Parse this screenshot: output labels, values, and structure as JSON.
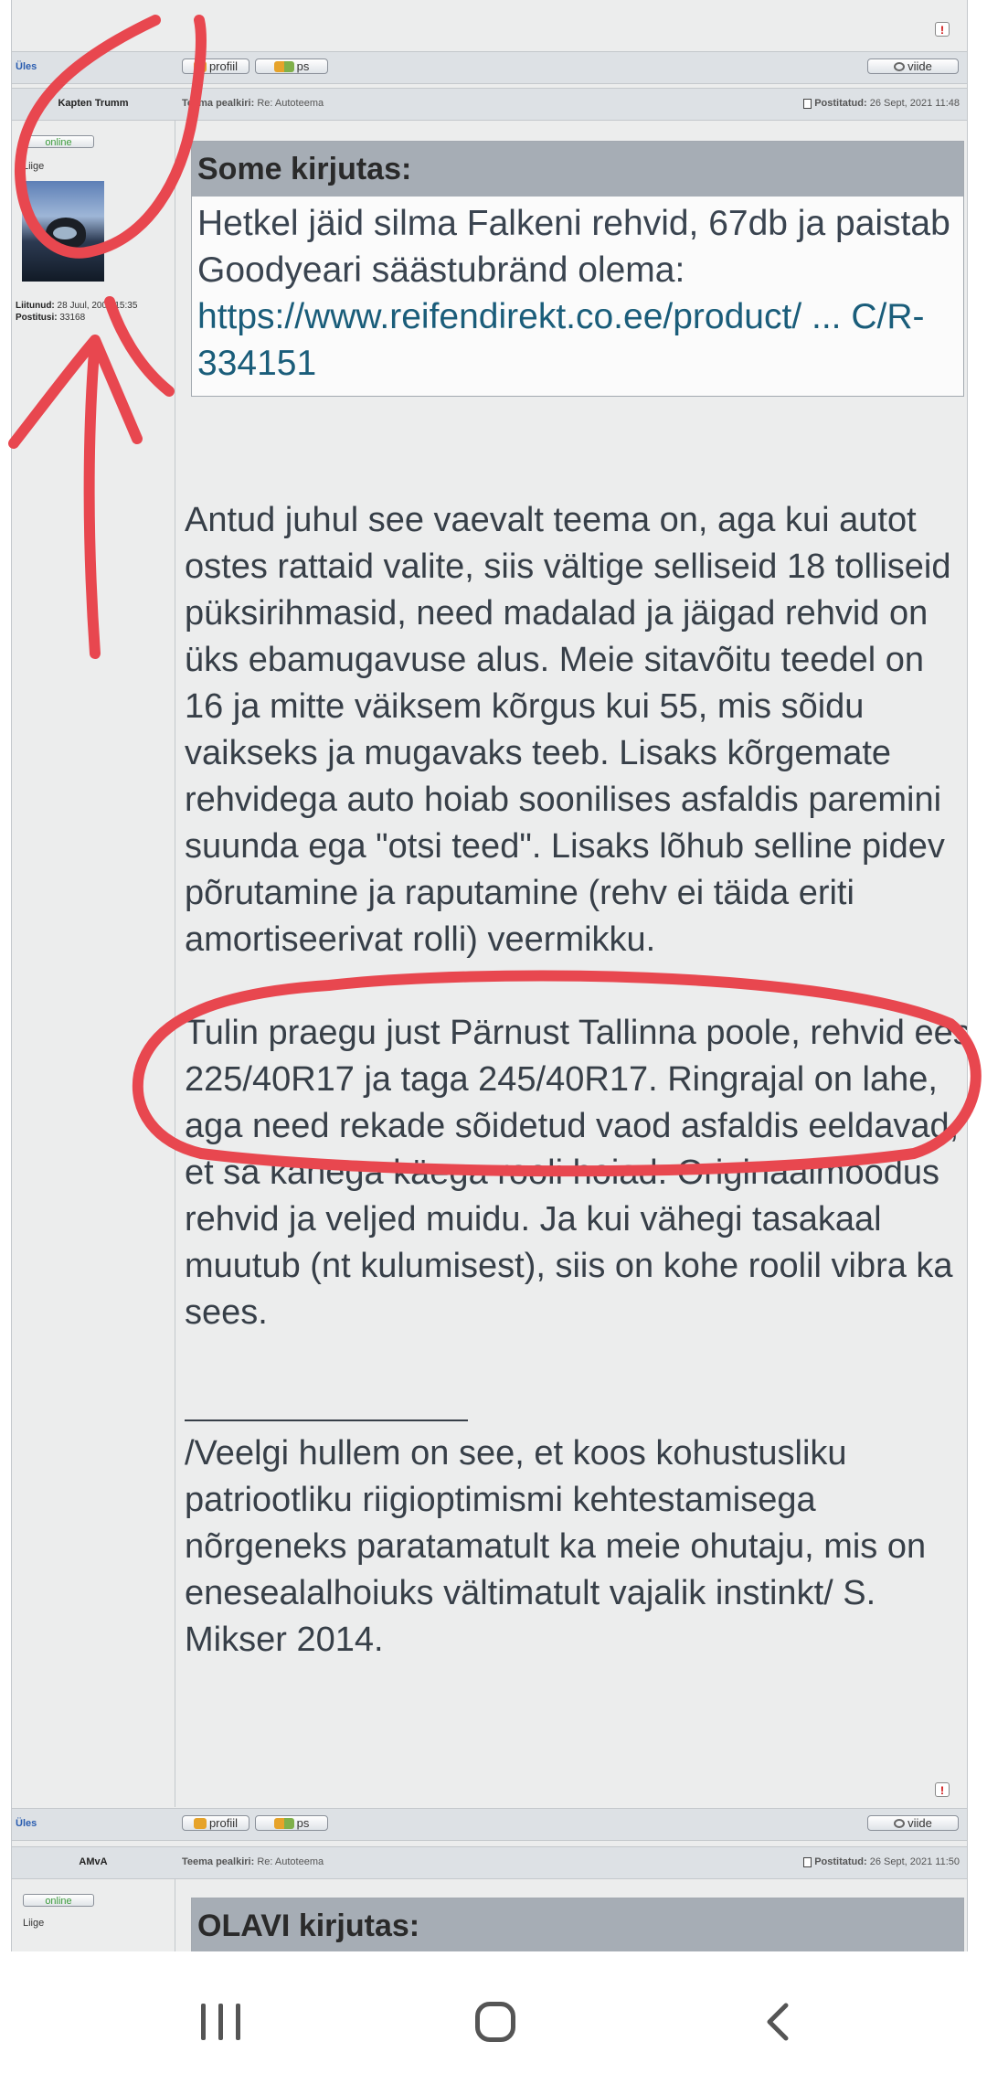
{
  "post1": {
    "top_report": "!",
    "up_link": "Üles",
    "profile_btn": "profiil",
    "pm_btn": "ps",
    "quote_btn": "viide",
    "author": "Kapten Trumm",
    "subject_label": "Teema pealkiri:",
    "subject_value": "Re: Autoteema",
    "posted_label": "Postitatud:",
    "posted_value": "26 Sept, 2021 11:48",
    "online_badge": "online",
    "rank": "Liige",
    "joined_label": "Liitunud:",
    "joined_value": "28 Juul, 2005 15:35",
    "posts_label": "Postitusi:",
    "posts_value": "33168",
    "quote_header": "Some kirjutas:",
    "quote_text": "Hetkel jäid silma Falkeni rehvid, 67db ja paistab Goodyeari säästubränd olema:",
    "quote_link": "https://www.reifendirekt.co.ee/product/ ... C/R-334151",
    "para1": "Antud juhul see vaevalt teema on, aga kui autot ostes rattaid valite, siis vältige selliseid 18 tolliseid püksirihmasid, need madalad ja jäigad rehvid on üks ebamugavuse alus. Meie sitavõitu teedel on 16 ja mitte väiksem kõrgus kui 55, mis sõidu vaikseks ja mugavaks teeb. Lisaks kõrgemate rehvidega auto hoiab soonilises asfaldis paremini suunda ega \"otsi teed\". Lisaks lõhub selline pidev põrutamine ja raputamine (rehv ei täida eriti amortiseerivat rolli) veermikku.",
    "para2": "Tulin praegu just Pärnust Tallinna poole, rehvid ees 225/40R17 ja taga 245/40R17. Ringrajal on lahe, aga need rekade sõidetud vaod asfaldis eeldavad, et sa kahega käega rooli hoiad. Originaalmõõdus rehvid ja veljed muidu. Ja kui vähegi tasakaal muutub (nt kulumisest), siis on kohe roolil vibra ka sees.",
    "signature": "/Veelgi hullem on see, et koos kohustusliku patriootliku riigioptimismi kehtestamisega nõrgeneks paratamatult ka meie ohutaju, mis on enesealalhoiuks vältimatult vajalik instinkt/ S. Mikser 2014.",
    "bottom_report": "!"
  },
  "post2": {
    "up_link": "Üles",
    "profile_btn": "profiil",
    "pm_btn": "ps",
    "quote_btn": "viide",
    "author": "AMvA",
    "subject_label": "Teema pealkiri:",
    "subject_value": "Re: Autoteema",
    "posted_label": "Postitatud:",
    "posted_value": "26 Sept, 2021 11:50",
    "online_badge": "online",
    "rank": "Liige",
    "quote_header": "OLAVI kirjutas:"
  },
  "annotation_color": "#e8474f",
  "navigation": {
    "icons": [
      "recent-apps-icon",
      "home-icon",
      "back-icon"
    ]
  }
}
